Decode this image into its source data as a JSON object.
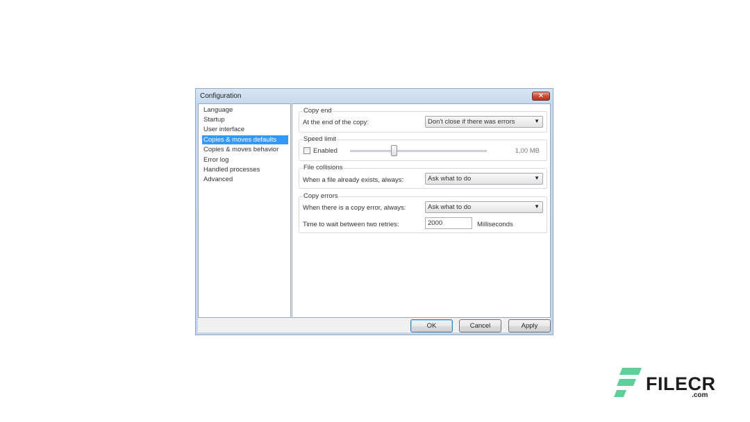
{
  "window": {
    "title": "Configuration",
    "close_glyph": "✕"
  },
  "sidebar": {
    "items": [
      {
        "label": "Language"
      },
      {
        "label": "Startup"
      },
      {
        "label": "User interface"
      },
      {
        "label": "Copies & moves defaults",
        "selected": true
      },
      {
        "label": "Copies & moves behavior"
      },
      {
        "label": "Error log"
      },
      {
        "label": "Handled processes"
      },
      {
        "label": "Advanced"
      }
    ]
  },
  "copy_end": {
    "title": "Copy end",
    "label": "At the end of the copy:",
    "value": "Don't close if there was errors"
  },
  "speed_limit": {
    "title": "Speed limit",
    "enabled_label": "Enabled",
    "enabled": false,
    "slider_fraction": 0.32,
    "value": "1,00 MB"
  },
  "file_collisions": {
    "title": "File collisions",
    "label": "When a file already exists, always:",
    "value": "Ask what to do"
  },
  "copy_errors": {
    "title": "Copy errors",
    "label": "When there is a copy error, always:",
    "value": "Ask what to do",
    "retry_label": "Time to wait between two retries:",
    "retry_value": "2000",
    "retry_unit": "Milliseconds"
  },
  "buttons": {
    "ok": "OK",
    "cancel": "Cancel",
    "apply": "Apply"
  },
  "combo_arrow": "▼",
  "watermark": {
    "brand": "FILECR",
    "sub": ".com",
    "color": "#5fcf9a"
  }
}
